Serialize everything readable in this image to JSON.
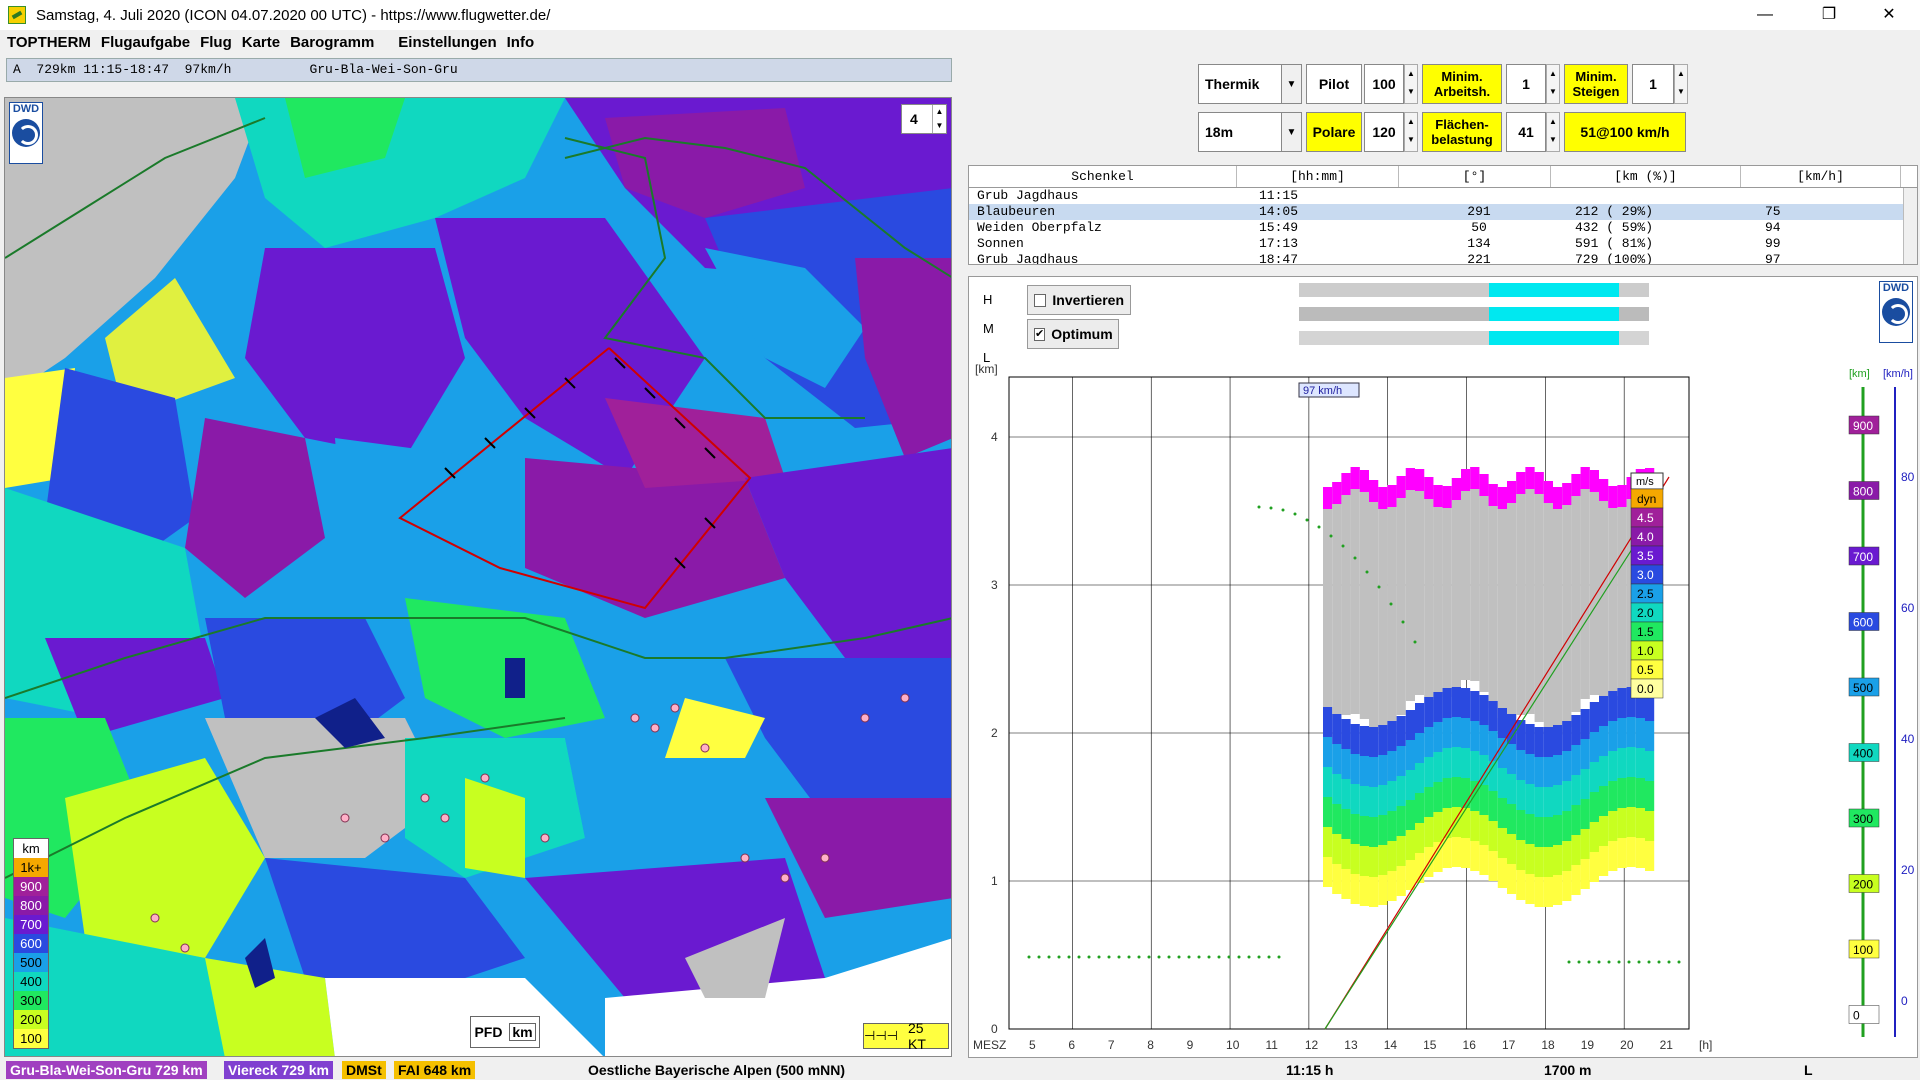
{
  "window": {
    "title": "Samstag, 4. Juli 2020 (ICON 04.07.2020 00 UTC) - https://www.flugwetter.de/",
    "minimize": "—",
    "maximize": "❐",
    "close": "✕"
  },
  "menu": {
    "app": "TOPTHERM",
    "items": [
      "Flugaufgabe",
      "Flug",
      "Karte",
      "Barogramm",
      "Einstellungen",
      "Info"
    ]
  },
  "infobar": "A  729km 11:15-18:47  97km/h          Gru-Bla-Wei-Son-Gru",
  "map": {
    "zoom_value": "4",
    "dwd_label": "DWD",
    "legend_unit": "km",
    "legend": [
      {
        "label": "1k+",
        "color": "#f5a800"
      },
      {
        "label": "900",
        "color": "#a0209a"
      },
      {
        "label": "800",
        "color": "#8a1aa8"
      },
      {
        "label": "700",
        "color": "#6a1ad0"
      },
      {
        "label": "600",
        "color": "#2a4ae0"
      },
      {
        "label": "500",
        "color": "#1aa0e8"
      },
      {
        "label": "400",
        "color": "#10d8c0"
      },
      {
        "label": "300",
        "color": "#20e860"
      },
      {
        "label": "200",
        "color": "#c8ff20"
      },
      {
        "label": "100",
        "color": "#ffff40"
      }
    ],
    "pfd_label": "PFD",
    "km_label": "km",
    "wind_label": "25 KT"
  },
  "controls": {
    "mode_select": "Thermik",
    "pilot_label": "Pilot",
    "pilot_value": "100",
    "min_arbeit_label": "Minim. Arbeitsh.",
    "min_arbeit_value": "1",
    "min_steigen_label": "Minim. Steigen",
    "min_steigen_value": "1",
    "class_select": "18m",
    "polare_label": "Polare",
    "polare_value": "120",
    "flaechen_label": "Flächen- belastung",
    "flaechen_value": "41",
    "speed_button": "51@100 km/h"
  },
  "table": {
    "headers": [
      "Schenkel",
      "[hh:mm]",
      "[°]",
      "[km (%)]",
      "[km/h]"
    ],
    "rows": [
      [
        "Grub Jagdhaus",
        "11:15",
        "",
        "",
        ""
      ],
      [
        "Blaubeuren",
        "14:05",
        "291",
        "212 ( 29%)",
        "75"
      ],
      [
        "Weiden Oberpfalz",
        "15:49",
        "50",
        "432 ( 59%)",
        "94"
      ],
      [
        "Sonnen",
        "17:13",
        "134",
        "591 ( 81%)",
        "99"
      ],
      [
        "Grub Jagdhaus",
        "18:47",
        "221",
        "729 (100%)",
        "97"
      ]
    ]
  },
  "chart_panel": {
    "invert_label": "Invertieren",
    "optimum_label": "Optimum",
    "optimum_check": "✔",
    "cloud_rows": [
      "H",
      "M",
      "L"
    ],
    "dwd_label": "DWD"
  },
  "chart_data": {
    "type": "heatmap",
    "ylabel": "[km]",
    "y_ticks": [
      "0",
      "1",
      "2",
      "3",
      "4"
    ],
    "x_axis_label": "MESZ",
    "x_ticks": [
      "5",
      "6",
      "7",
      "8",
      "9",
      "10",
      "11",
      "12",
      "13",
      "14",
      "15",
      "16",
      "17",
      "18",
      "19",
      "20",
      "21",
      "[h]"
    ],
    "speed_annotation": "97 km/h",
    "ms_legend_title": "m/s",
    "ms_legend": [
      {
        "label": "dyn",
        "color": "#f5a800"
      },
      {
        "label": "4.5",
        "color": "#a0209a"
      },
      {
        "label": "4.0",
        "color": "#8a1aa8"
      },
      {
        "label": "3.5",
        "color": "#6a1ad0"
      },
      {
        "label": "3.0",
        "color": "#2a4ae0"
      },
      {
        "label": "2.5",
        "color": "#1aa0e8"
      },
      {
        "label": "2.0",
        "color": "#10d8c0"
      },
      {
        "label": "1.5",
        "color": "#20e860"
      },
      {
        "label": "1.0",
        "color": "#c8ff20"
      },
      {
        "label": "0.5",
        "color": "#ffff40"
      },
      {
        "label": "0.0",
        "color": "#ffffa0"
      }
    ],
    "right_axis_km_label": "[km]",
    "right_axis_kmh_label": "[km/h]",
    "right_axis_km_ticks": [
      "900",
      "800",
      "700",
      "600",
      "500",
      "400",
      "300",
      "200",
      "100",
      "0"
    ],
    "right_axis_kmh_ticks": [
      "80",
      "60",
      "40",
      "20",
      "0"
    ]
  },
  "status": {
    "tasks": [
      {
        "label": "Gru-Bla-Wei-Son-Gru 729 km",
        "color": "#a040c0"
      },
      {
        "label": "Viereck 729 km",
        "color": "#8040d0"
      },
      {
        "label": "DMSt",
        "color": "#f5c000"
      },
      {
        "label": "FAI 648 km",
        "color": "#f5c000"
      }
    ],
    "region": "Oestliche Bayerische Alpen (500 mNN)",
    "time": "11:15 h",
    "altitude": "1700 m",
    "layer": "L"
  }
}
